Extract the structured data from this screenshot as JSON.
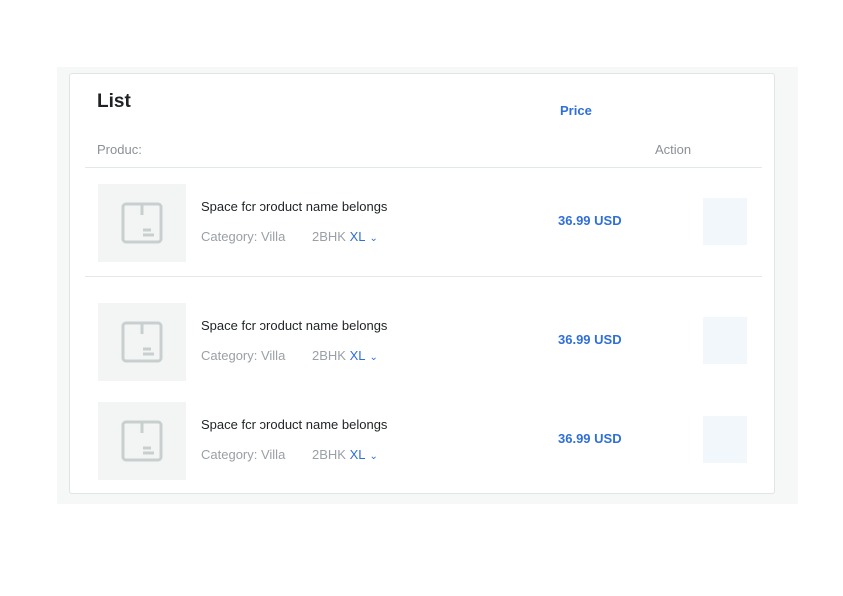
{
  "card": {
    "title": "List"
  },
  "columns": {
    "product": "Produc:",
    "price": "Price",
    "action": "Action"
  },
  "rows": [
    {
      "name": "Space fcr ɔroduct name belongs",
      "category": "Category: Villa",
      "size_prefix": "2BHK",
      "size": "XL",
      "price": "36.99 USD"
    },
    {
      "name": "Space fcr ɔroduct name belongs",
      "category": "Category: Villa",
      "size_prefix": "2BHK",
      "size": "XL",
      "price": "36.99 USD"
    },
    {
      "name": "Space fcr ɔroduct name belongs",
      "category": "Category: Villa",
      "size_prefix": "2BHK",
      "size": "XL",
      "price": "36.99 USD"
    }
  ],
  "icons": {
    "thumbnail": "box-icon",
    "size_dropdown": "chevron-down-icon"
  }
}
